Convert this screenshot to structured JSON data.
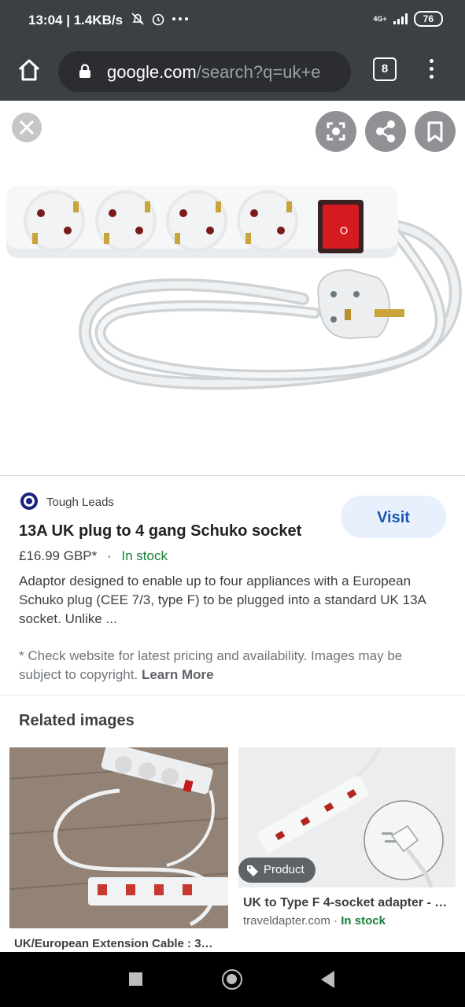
{
  "status_bar": {
    "time": "13:04",
    "speed": "| 1.4KB/s",
    "network": "4G+",
    "battery": "76"
  },
  "browser": {
    "url_domain": "google.com",
    "url_path": "/search?q=uk+e",
    "tab_count": "8"
  },
  "result": {
    "source": "Tough Leads",
    "visit_label": "Visit",
    "title": "13A UK plug to 4 gang Schuko socket",
    "price": "£16.99 GBP*",
    "separator": "·",
    "stock": "In stock",
    "description": "Adaptor designed to enable up to four appliances with a European Schuko plug (CEE 7/3, type F) to be plugged into a standard UK 13A socket. Unlike ...",
    "disclaimer": "* Check website for latest pricing and availability. Images may be subject to copyright.",
    "learn_more": "Learn More"
  },
  "related": {
    "heading": "Related images",
    "items": [
      {
        "title": "UK/European Extension Cable : 3…"
      },
      {
        "badge": "Product",
        "title": "UK to Type F 4-socket adapter - …",
        "site": "traveldapter.com",
        "dot": "·",
        "stock": "In stock"
      }
    ]
  },
  "colors": {
    "chrome_bar": "#3c4043",
    "visit_bg": "#e8f0fe",
    "visit_text": "#1a56b0",
    "in_stock": "#188038",
    "switch_red": "#d61b20"
  },
  "icons": [
    "home-icon",
    "lock-icon",
    "tabs-icon",
    "menu-icon",
    "close-icon",
    "lens-icon",
    "share-icon",
    "bookmark-icon",
    "tag-icon"
  ]
}
